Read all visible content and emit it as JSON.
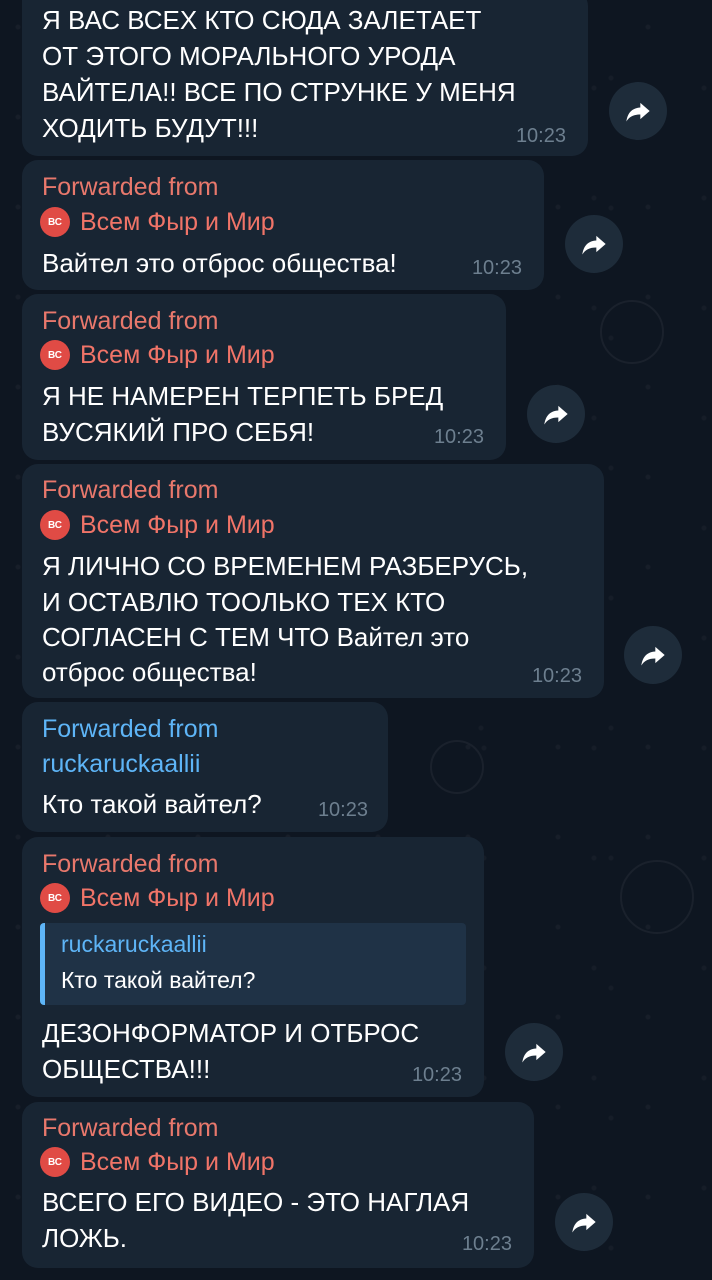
{
  "messages": [
    {
      "text_lines": [
        "Я ВАС ВСЕХ КТО СЮДА ЗАЛЕТАЕТ",
        "ОТ ЭТОГО МОРАЛЬНОГО УРОДА",
        "ВАЙТЕЛА!! ВСЕ ПО СТРУНКЕ У МЕНЯ",
        "ХОДИТЬ БУДУТ!!!"
      ],
      "time": "10:23"
    },
    {
      "forwarded_label": "Forwarded from",
      "sender": "Всем Фыр и Мир",
      "avatar_initials": "ВС",
      "text_lines": [
        "Вайтел это отброс общества!"
      ],
      "time": "10:23"
    },
    {
      "forwarded_label": "Forwarded from",
      "sender": "Всем Фыр и Мир",
      "avatar_initials": "ВС",
      "text_lines": [
        "Я НЕ НАМЕРЕН ТЕРПЕТЬ БРЕД",
        "ВУСЯКИЙ ПРО СЕБЯ!"
      ],
      "time": "10:23"
    },
    {
      "forwarded_label": "Forwarded from",
      "sender": "Всем Фыр и Мир",
      "avatar_initials": "ВС",
      "text_lines": [
        "Я ЛИЧНО СО ВРЕМЕНЕМ РАЗБЕРУСЬ,",
        "И ОСТАВЛЮ ТООЛЬКО ТЕХ КТО",
        "СОГЛАСЕН С ТЕМ ЧТО Вайтел это",
        "отброс общества!"
      ],
      "time": "10:23"
    },
    {
      "forwarded_label": "Forwarded from",
      "sender": "ruckaruckaallii",
      "text_lines": [
        "Кто такой вайтел?"
      ],
      "time": "10:23"
    },
    {
      "forwarded_label": "Forwarded from",
      "sender": "Всем Фыр и Мир",
      "avatar_initials": "ВС",
      "reply": {
        "name": "ruckaruckaallii",
        "text": "Кто такой вайтел?"
      },
      "text_lines": [
        "ДЕЗОНФОРМАТОР И ОТБРОС",
        "ОБЩЕСТВА!!!"
      ],
      "time": "10:23"
    },
    {
      "forwarded_label": "Forwarded from",
      "sender": "Всем Фыр и Мир",
      "avatar_initials": "ВС",
      "text_lines": [
        "ВСЕГО ЕГО ВИДЕО - ЭТО НАГЛАЯ",
        "ЛОЖЬ."
      ],
      "time": "10:23"
    }
  ],
  "colors": {
    "background": "#0e1621",
    "bubble": "#182533",
    "forward_label": "#e8786c",
    "sender_name": "#f07468",
    "link_blue": "#5eb5f7",
    "avatar": "#e04b45",
    "time": "#6d7f8f"
  },
  "icons": {
    "share": "share-arrow-icon"
  }
}
